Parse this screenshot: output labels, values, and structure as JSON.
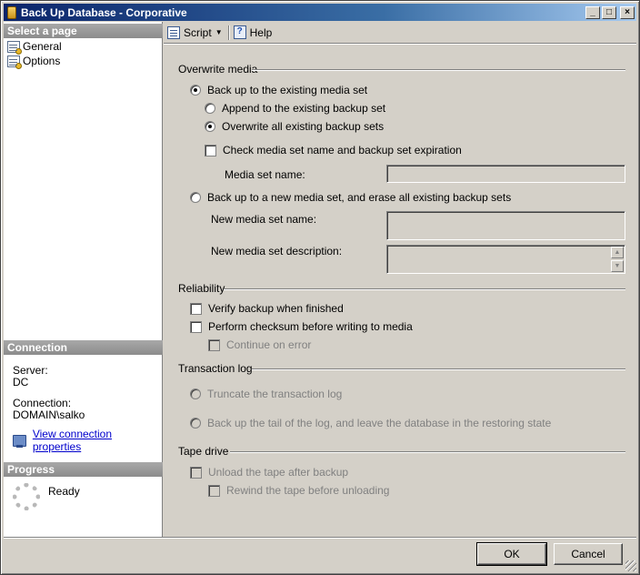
{
  "window": {
    "title": "Back Up Database - Corporative"
  },
  "titlebar_buttons": {
    "minimize": "_",
    "maximize": "□",
    "close": "×"
  },
  "left_panel": {
    "select_page_header": "Select a page",
    "pages": [
      {
        "label": "General"
      },
      {
        "label": "Options"
      }
    ],
    "connection_header": "Connection",
    "server_label": "Server:",
    "server_value": "DC",
    "connection_label": "Connection:",
    "connection_value": "DOMAIN\\salko",
    "view_connection_properties": "View connection properties",
    "progress_header": "Progress",
    "progress_status": "Ready"
  },
  "toolbar": {
    "script_label": "Script",
    "script_dropdown": "▼",
    "help_label": "Help"
  },
  "overwrite_media": {
    "header": "Overwrite media",
    "existing_set": "Back up to the existing media set",
    "append": "Append to the existing backup set",
    "overwrite": "Overwrite all existing backup sets",
    "check_media": "Check media set name and backup set expiration",
    "media_set_name_label": "Media set name:",
    "new_set": "Back up to a new media set, and erase all existing backup sets",
    "new_media_set_name_label": "New media set name:",
    "new_media_set_description_label": "New media set description:"
  },
  "reliability": {
    "header": "Reliability",
    "verify": "Verify backup when finished",
    "checksum": "Perform checksum before writing to media",
    "continue_on_error": "Continue on error"
  },
  "transaction_log": {
    "header": "Transaction log",
    "truncate": "Truncate the transaction log",
    "tail": "Back up the tail of the log, and leave the database in the restoring state"
  },
  "tape_drive": {
    "header": "Tape drive",
    "unload": "Unload the tape after backup",
    "rewind": "Rewind the tape before unloading"
  },
  "buttons": {
    "ok": "OK",
    "cancel": "Cancel"
  },
  "scroll_arrows": {
    "up": "▲",
    "down": "▼"
  }
}
